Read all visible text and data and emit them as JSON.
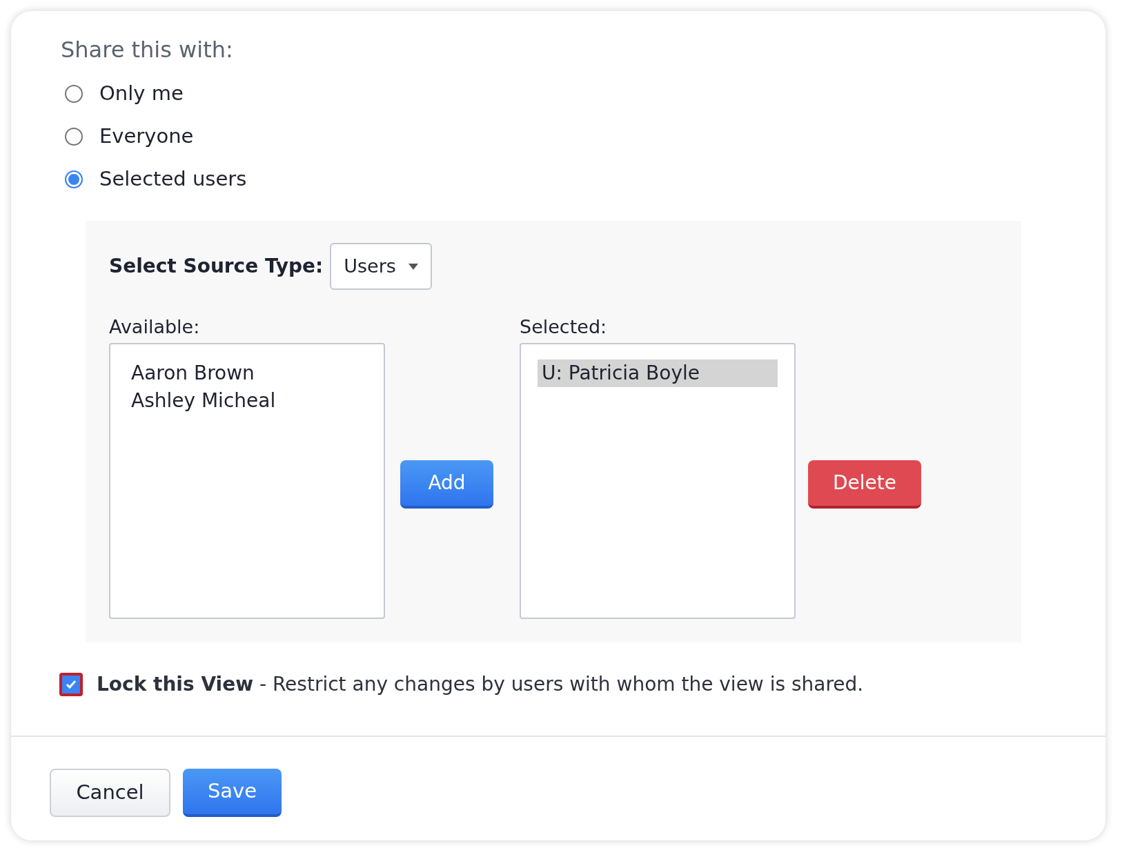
{
  "share": {
    "title": "Share this with:",
    "options": [
      {
        "label": "Only me",
        "selected": false
      },
      {
        "label": "Everyone",
        "selected": false
      },
      {
        "label": "Selected users",
        "selected": true
      }
    ]
  },
  "source": {
    "label": "Select Source Type:",
    "value": "Users"
  },
  "available": {
    "label": "Available:",
    "items": [
      {
        "label": "Aaron Brown",
        "selected": false
      },
      {
        "label": "Ashley Micheal",
        "selected": false
      }
    ]
  },
  "add_button": "Add",
  "selected_list": {
    "label": "Selected:",
    "items": [
      {
        "label": "U: Patricia Boyle",
        "selected": true
      }
    ]
  },
  "delete_button": "Delete",
  "lock": {
    "checked": true,
    "text": "**Lock this View** - Restrict any changes by users with whom the view is shared."
  },
  "buttons": [
    {
      "label": "Cancel",
      "kind": "secondary"
    },
    {
      "label": "Save",
      "kind": "primary"
    }
  ]
}
